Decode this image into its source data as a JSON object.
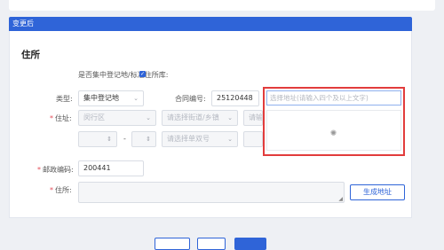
{
  "header": {
    "banner_title": "变更后"
  },
  "section": {
    "title": "住所"
  },
  "centralized": {
    "label": "是否集中登记地/标准住所库:",
    "checked": true
  },
  "form": {
    "type_label": "类型:",
    "type_value": "集中登记地",
    "contract_label": "合同编号:",
    "contract_value": "25120448",
    "address_label": "住址:",
    "district_value": "闵行区",
    "street_placeholder": "请选择街道/乡镇",
    "more_placeholder": "请输",
    "dash": "-",
    "building_placeholder": "请选择单双号",
    "postal_label": "邮政编码:",
    "postal_value": "200441",
    "residence_label": "住所:",
    "generate_button": "生成地址"
  },
  "address_popup": {
    "search_placeholder": "选择地址(请输入四个及以上文字)",
    "loading_icon": "spinner-icon"
  },
  "colors": {
    "accent": "#2f64d8",
    "highlight": "#e23c3c",
    "required": "#e34d59"
  }
}
